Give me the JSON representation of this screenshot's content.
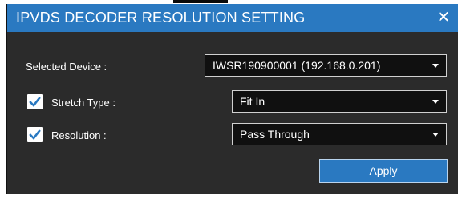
{
  "dialog": {
    "title": "IPVDS DECODER RESOLUTION SETTING",
    "close_glyph": "✕",
    "accent_color": "#2a79c1"
  },
  "selected_device": {
    "label": "Selected Device :",
    "value": "IWSR190900001 (192.168.0.201)"
  },
  "stretch_type": {
    "label": "Stretch Type :",
    "checked": true,
    "value": "Fit In"
  },
  "resolution": {
    "label": "Resolution :",
    "checked": true,
    "value": "Pass Through"
  },
  "actions": {
    "apply_label": "Apply"
  }
}
